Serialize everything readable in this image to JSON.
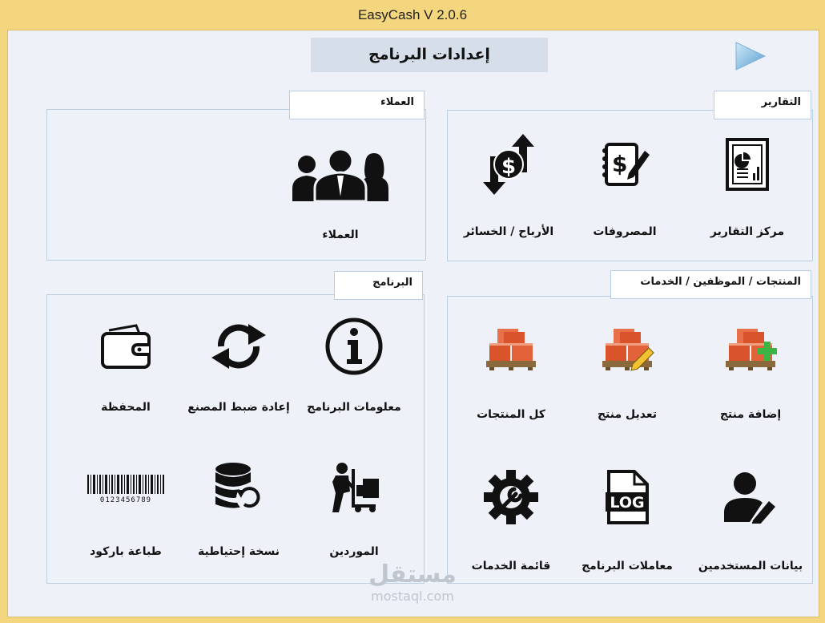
{
  "window": {
    "title": "EasyCash V 2.0.6"
  },
  "page": {
    "title": "إعدادات البرنامج"
  },
  "panels": {
    "reports": {
      "title": "التقارير",
      "items": [
        {
          "label": "مركز التقارير",
          "icon": "report-icon"
        },
        {
          "label": "المصروفات",
          "icon": "expenses-icon"
        },
        {
          "label": "الأرباح / الخسائر",
          "icon": "profit-loss-icon"
        }
      ]
    },
    "customers": {
      "title": "العملاء",
      "items": [
        {
          "label": "العملاء",
          "icon": "customers-icon"
        }
      ]
    },
    "products": {
      "title": "المنتجات / الموظفين / الخدمات",
      "items": [
        {
          "label": "إضافة منتج",
          "icon": "add-product-icon"
        },
        {
          "label": "تعديل منتج",
          "icon": "edit-product-icon"
        },
        {
          "label": "كل المنتجات",
          "icon": "all-products-icon"
        },
        {
          "label": "بيانات المستخدمين",
          "icon": "user-edit-icon"
        },
        {
          "label": "معاملات البرنامج",
          "icon": "log-file-icon"
        },
        {
          "label": "قائمة الخدمات",
          "icon": "services-gear-icon"
        }
      ]
    },
    "program": {
      "title": "البرنامج",
      "items": [
        {
          "label": "معلومات البرنامج",
          "icon": "info-icon"
        },
        {
          "label": "إعادة ضبط المصنع",
          "icon": "refresh-icon"
        },
        {
          "label": "المحفظة",
          "icon": "wallet-icon"
        },
        {
          "label": "الموردين",
          "icon": "supplier-cart-icon"
        },
        {
          "label": "نسخة إحتياطية",
          "icon": "database-backup-icon"
        },
        {
          "label": "طباعة باركود",
          "icon": "barcode-icon"
        }
      ]
    }
  },
  "barcode_digits": "0123456789",
  "watermark": {
    "arabic": "مستقل",
    "latin": "mostaql.com"
  }
}
